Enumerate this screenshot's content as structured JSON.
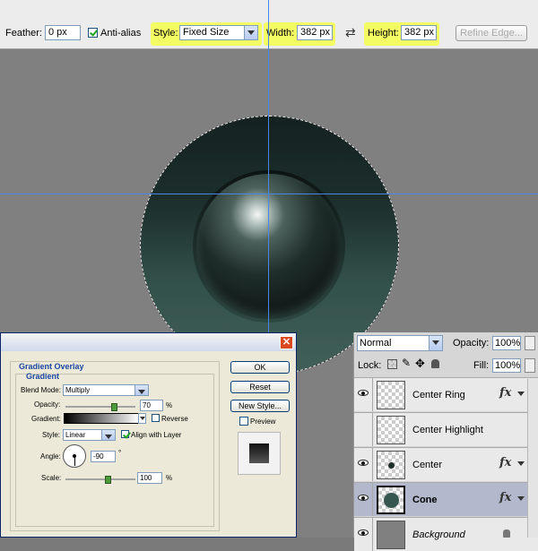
{
  "options_bar": {
    "feather_label": "Feather:",
    "feather_value": "0 px",
    "antialias_label": "Anti-alias",
    "antialias_checked": true,
    "style_label": "Style:",
    "style_value": "Fixed Size",
    "width_label": "Width:",
    "width_value": "382 px",
    "height_label": "Height:",
    "height_value": "382 px",
    "swap_icon": "swap-arrows-icon",
    "refine_edge_label": "Refine Edge...",
    "highlight_color": "#f4ff54"
  },
  "dialog": {
    "close_symbol": "✕",
    "section_title": "Gradient Overlay",
    "group_title": "Gradient",
    "blend_mode_label": "Blend Mode:",
    "blend_mode_value": "Multiply",
    "opacity_label": "Opacity:",
    "opacity_value": "70",
    "opacity_unit": "%",
    "gradient_label": "Gradient:",
    "reverse_label": "Reverse",
    "style_label": "Style:",
    "style_value": "Linear",
    "align_label": "Align with Layer",
    "angle_label": "Angle:",
    "angle_value": "-90",
    "angle_unit": "°",
    "scale_label": "Scale:",
    "scale_value": "100",
    "scale_unit": "%",
    "ok_label": "OK",
    "reset_label": "Reset",
    "new_style_label": "New Style...",
    "preview_label": "Preview"
  },
  "layers_panel": {
    "blend_mode": "Normal",
    "opacity_label": "Opacity:",
    "opacity_value": "100%",
    "lock_label": "Lock:",
    "fill_label": "Fill:",
    "fill_value": "100%",
    "layers": [
      {
        "name": "Center Ring",
        "visible": true,
        "fx": true,
        "selected": false
      },
      {
        "name": "Center Highlight",
        "visible": false,
        "fx": false,
        "selected": false
      },
      {
        "name": "Center",
        "visible": true,
        "fx": true,
        "selected": false
      },
      {
        "name": "Cone",
        "visible": true,
        "fx": true,
        "selected": true
      },
      {
        "name": "Background",
        "visible": true,
        "fx": false,
        "selected": false
      }
    ],
    "fx_symbol": "fx"
  }
}
